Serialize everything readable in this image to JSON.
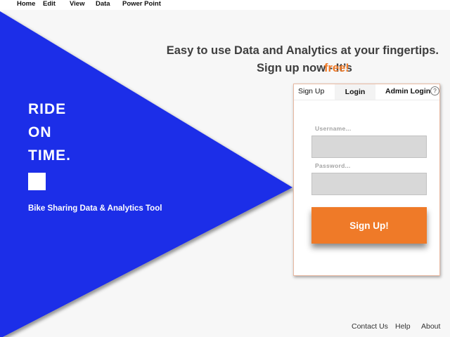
{
  "menubar": {
    "items": [
      "Home",
      "Edit",
      "View",
      "Data",
      "Power Point"
    ]
  },
  "colors": {
    "hero_blue": "#1f2ee8",
    "accent_orange": "#ef7a28",
    "background": "#f7f7f7"
  },
  "brand": {
    "lines": [
      "RIDE",
      "ON",
      "TIME."
    ],
    "tagline": "Bike Sharing Data & Analytics Tool"
  },
  "headline": {
    "line1": "Easy to use Data and Analytics at your fingertips.",
    "line2": "Sign up now - It’s",
    "highlight": "free!"
  },
  "auth_card": {
    "tabs": {
      "signup": "Sign Up",
      "login": "Login",
      "admin": "Admin Login"
    },
    "help_icon": "question-circle-icon",
    "help_glyph": "?",
    "username": {
      "placeholder": "Username...",
      "value": ""
    },
    "password": {
      "placeholder": "Password...",
      "value": ""
    },
    "submit_label": "Sign Up!"
  },
  "footer": {
    "links": [
      "Contact Us",
      "Help",
      "About"
    ]
  }
}
